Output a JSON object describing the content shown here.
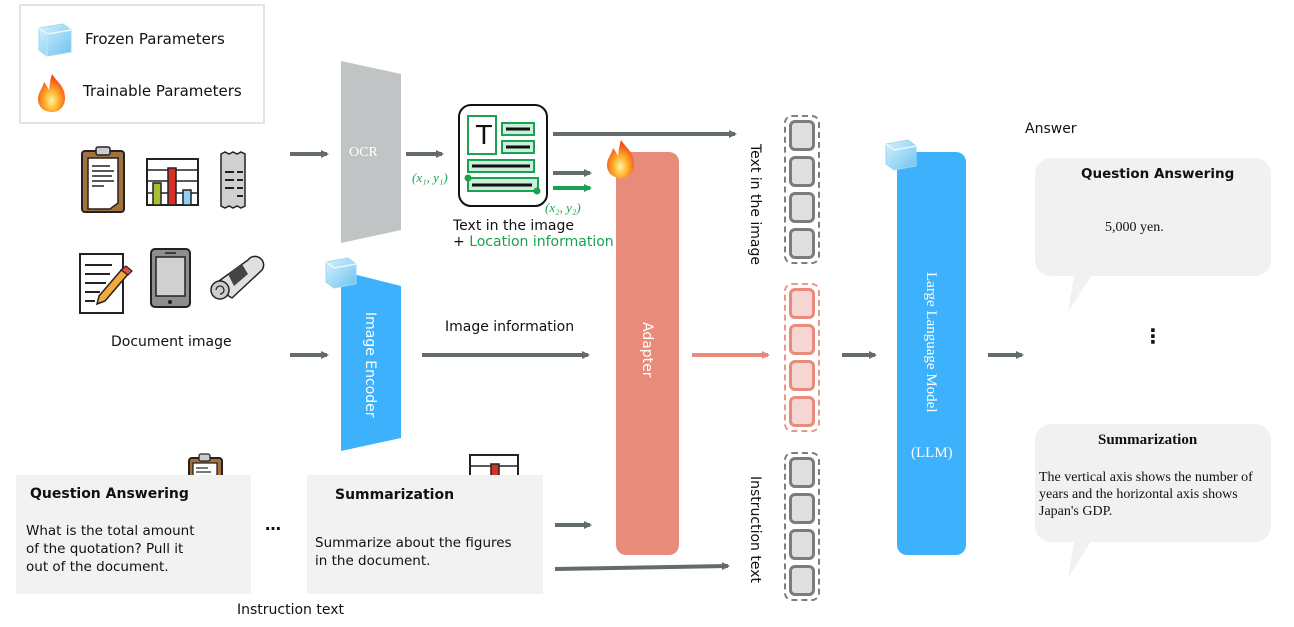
{
  "legend": {
    "frozen_label": "Frozen Parameters",
    "trainable_label": "Trainable Parameters"
  },
  "document_image": {
    "label": "Document image",
    "icons": [
      "clipboard-document",
      "bar-chart",
      "receipt",
      "document-with-pencil",
      "smartphone",
      "rolled-newspaper"
    ]
  },
  "ocr": {
    "label": "OCR",
    "output_label_line1": "Text in the image",
    "output_label_plus": "+ ",
    "output_label_line2": "Location information",
    "coord_top_left": "(x₁, y₁)",
    "coord_bottom_right": "(x₂, y₂)"
  },
  "image_encoder": {
    "label": "Image Encoder",
    "output_label": "Image information"
  },
  "adapter": {
    "label": "Adapter"
  },
  "tokens": {
    "text_label": "Text in the image",
    "instruction_label": "Instruction text",
    "count_per_group": 4
  },
  "llm": {
    "label_line1": "Large Language Model",
    "label_line2": "(LLM)"
  },
  "instructions": {
    "section_label": "Instruction text",
    "ellipsis": "…",
    "qa": {
      "title": "Question Answering",
      "body": "What is the total amount of the quotation? Pull it out of the document."
    },
    "summ": {
      "title": "Summarization",
      "body": "Summarize about the figures in the document."
    }
  },
  "answers": {
    "section_label": "Answer",
    "vertical_ellipsis": "⋮",
    "qa": {
      "title": "Question Answering",
      "body": "5,000 yen."
    },
    "summ": {
      "title": "Summarization",
      "body": "The vertical axis shows the number of years and the horizontal axis shows Japan's GDP."
    }
  },
  "colors": {
    "frozen_blue": "#3db1fb",
    "adapter_salmon": "#e98b7a",
    "ocr_gray": "#c1c4c5",
    "arrow_gray": "#636b6b",
    "location_green": "#1aa250"
  }
}
